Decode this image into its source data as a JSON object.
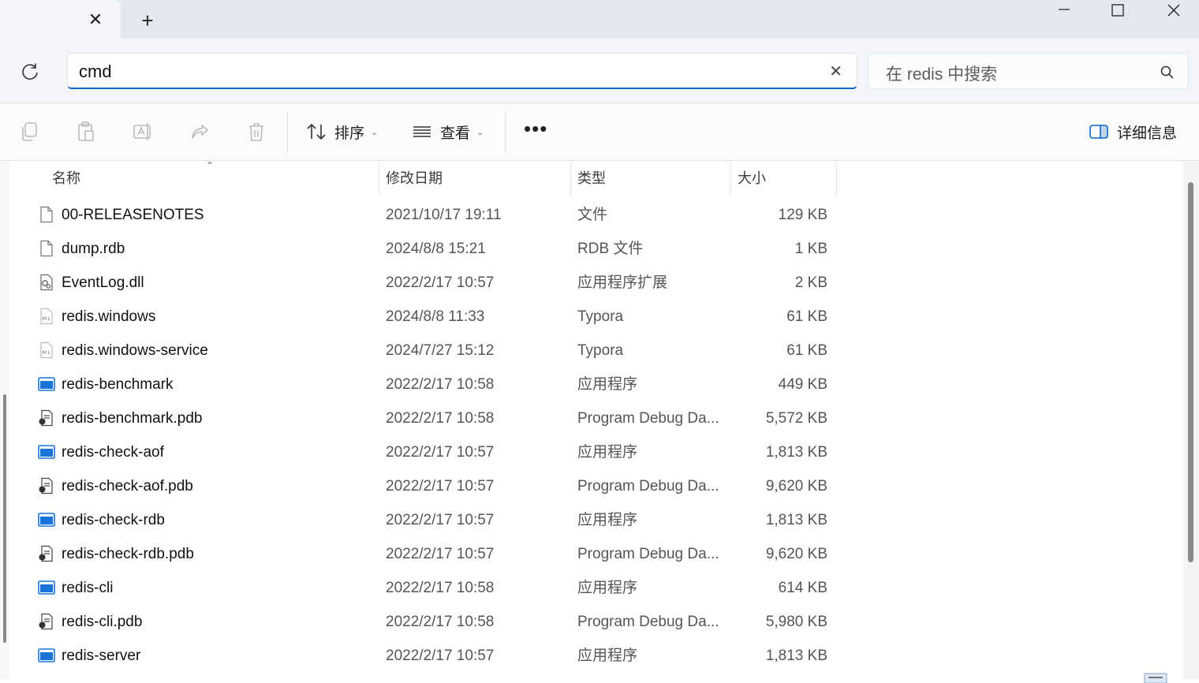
{
  "tab": {
    "close_glyph": "✕",
    "new_tab_glyph": "+"
  },
  "window_controls": {
    "minimize": "—",
    "maximize": "☐",
    "close": "✕"
  },
  "address": {
    "value": "cmd",
    "clear_glyph": "✕"
  },
  "search": {
    "placeholder": "在 redis 中搜索"
  },
  "toolbar": {
    "icons": [
      "copy-icon",
      "paste-icon",
      "rename-icon",
      "share-icon",
      "delete-icon"
    ],
    "sort_label": "排序",
    "view_label": "查看",
    "more_label": "•••",
    "details_label": "详细信息"
  },
  "columns": {
    "name": "名称",
    "date": "修改日期",
    "type": "类型",
    "size": "大小"
  },
  "files": [
    {
      "name": "00-RELEASENOTES",
      "date": "2021/10/17 19:11",
      "type": "文件",
      "size": "129 KB",
      "icon": "blank-file-icon"
    },
    {
      "name": "dump.rdb",
      "date": "2024/8/8 15:21",
      "type": "RDB 文件",
      "size": "1 KB",
      "icon": "blank-file-icon"
    },
    {
      "name": "EventLog.dll",
      "date": "2022/2/17 10:57",
      "type": "应用程序扩展",
      "size": "2 KB",
      "icon": "dll-file-icon"
    },
    {
      "name": "redis.windows",
      "date": "2024/8/8 11:33",
      "type": "Typora",
      "size": "61 KB",
      "icon": "markdown-file-icon"
    },
    {
      "name": "redis.windows-service",
      "date": "2024/7/27 15:12",
      "type": "Typora",
      "size": "61 KB",
      "icon": "markdown-file-icon"
    },
    {
      "name": "redis-benchmark",
      "date": "2022/2/17 10:58",
      "type": "应用程序",
      "size": "449 KB",
      "icon": "exe-icon"
    },
    {
      "name": "redis-benchmark.pdb",
      "date": "2022/2/17 10:58",
      "type": "Program Debug Da...",
      "size": "5,572 KB",
      "icon": "pdb-file-icon"
    },
    {
      "name": "redis-check-aof",
      "date": "2022/2/17 10:57",
      "type": "应用程序",
      "size": "1,813 KB",
      "icon": "exe-icon"
    },
    {
      "name": "redis-check-aof.pdb",
      "date": "2022/2/17 10:57",
      "type": "Program Debug Da...",
      "size": "9,620 KB",
      "icon": "pdb-file-icon"
    },
    {
      "name": "redis-check-rdb",
      "date": "2022/2/17 10:57",
      "type": "应用程序",
      "size": "1,813 KB",
      "icon": "exe-icon"
    },
    {
      "name": "redis-check-rdb.pdb",
      "date": "2022/2/17 10:57",
      "type": "Program Debug Da...",
      "size": "9,620 KB",
      "icon": "pdb-file-icon"
    },
    {
      "name": "redis-cli",
      "date": "2022/2/17 10:58",
      "type": "应用程序",
      "size": "614 KB",
      "icon": "exe-icon"
    },
    {
      "name": "redis-cli.pdb",
      "date": "2022/2/17 10:58",
      "type": "Program Debug Da...",
      "size": "5,980 KB",
      "icon": "pdb-file-icon"
    },
    {
      "name": "redis-server",
      "date": "2022/2/17 10:57",
      "type": "应用程序",
      "size": "1,813 KB",
      "icon": "exe-icon"
    }
  ],
  "colors": {
    "accent": "#0a66c2",
    "exe_blue": "#1a73d9",
    "tabstrip": "#e3e8ef",
    "addrbar": "#f3f5f8"
  }
}
